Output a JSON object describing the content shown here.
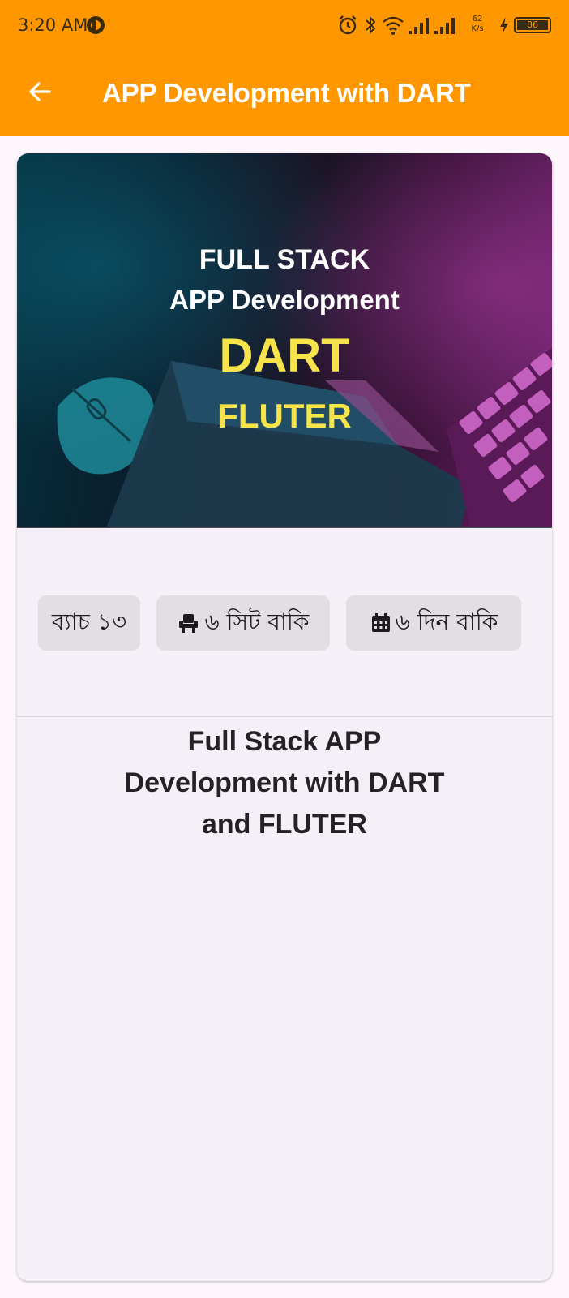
{
  "status_bar": {
    "time": "3:20 AM",
    "net_speed": "62",
    "net_unit": "K/s",
    "battery": "86"
  },
  "toolbar": {
    "title": "APP Development with DART"
  },
  "banner": {
    "line1": "FULL STACK",
    "line2": "APP Development",
    "line3": "DART",
    "line4": "FLUTER"
  },
  "chips": {
    "batch": "ব্যাচ ১৩",
    "seats": "৬ সিট বাকি",
    "days": "৬ দিন বাকি"
  },
  "course": {
    "title": "Full Stack APP Development with DART and FLUTER"
  },
  "colors": {
    "app_bar": "#ff9800",
    "banner_highlight": "#f6e44a",
    "chip_background": "#e2dfe3"
  }
}
